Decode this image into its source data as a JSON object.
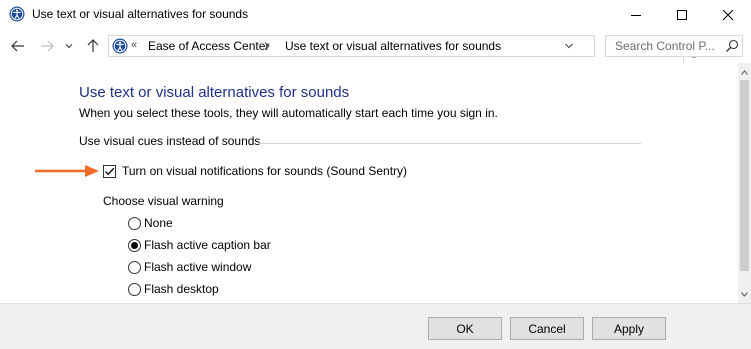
{
  "window": {
    "title": "Use text or visual alternatives for sounds",
    "icons": {
      "app": "ease-of-access-icon",
      "minimize": "minimize-icon",
      "maximize": "maximize-icon",
      "close": "close-icon"
    }
  },
  "navigation": {
    "back_icon": "arrow-left-icon",
    "forward_icon": "arrow-right-icon",
    "recent_icon": "chevron-down-icon",
    "up_icon": "arrow-up-icon",
    "breadcrumb": {
      "overflow": "«",
      "items": [
        "Ease of Access Center",
        "Use text or visual alternatives for sounds"
      ]
    },
    "refresh_icon": "refresh-icon",
    "search": {
      "placeholder": "Search Control P...",
      "icon": "search-icon"
    }
  },
  "main": {
    "title": "Use text or visual alternatives for sounds",
    "subtitle": "When you select these tools, they will automatically start each time you sign in.",
    "section_header": "Use visual cues instead of sounds",
    "sound_sentry": {
      "label": "Turn on visual notifications for sounds (Sound Sentry)",
      "checked": true
    },
    "visual_warning": {
      "label": "Choose visual warning",
      "options": [
        {
          "label": "None",
          "selected": false
        },
        {
          "label": "Flash active caption bar",
          "selected": true
        },
        {
          "label": "Flash active window",
          "selected": false
        },
        {
          "label": "Flash desktop",
          "selected": false
        }
      ]
    }
  },
  "annotation": {
    "arrow_color": "#f26b2a"
  },
  "buttons": {
    "ok": "OK",
    "cancel": "Cancel",
    "apply": "Apply"
  },
  "colors": {
    "title": "#1e3287",
    "footer_bg": "#f0f0f0",
    "button_bg": "#e1e1e1"
  }
}
